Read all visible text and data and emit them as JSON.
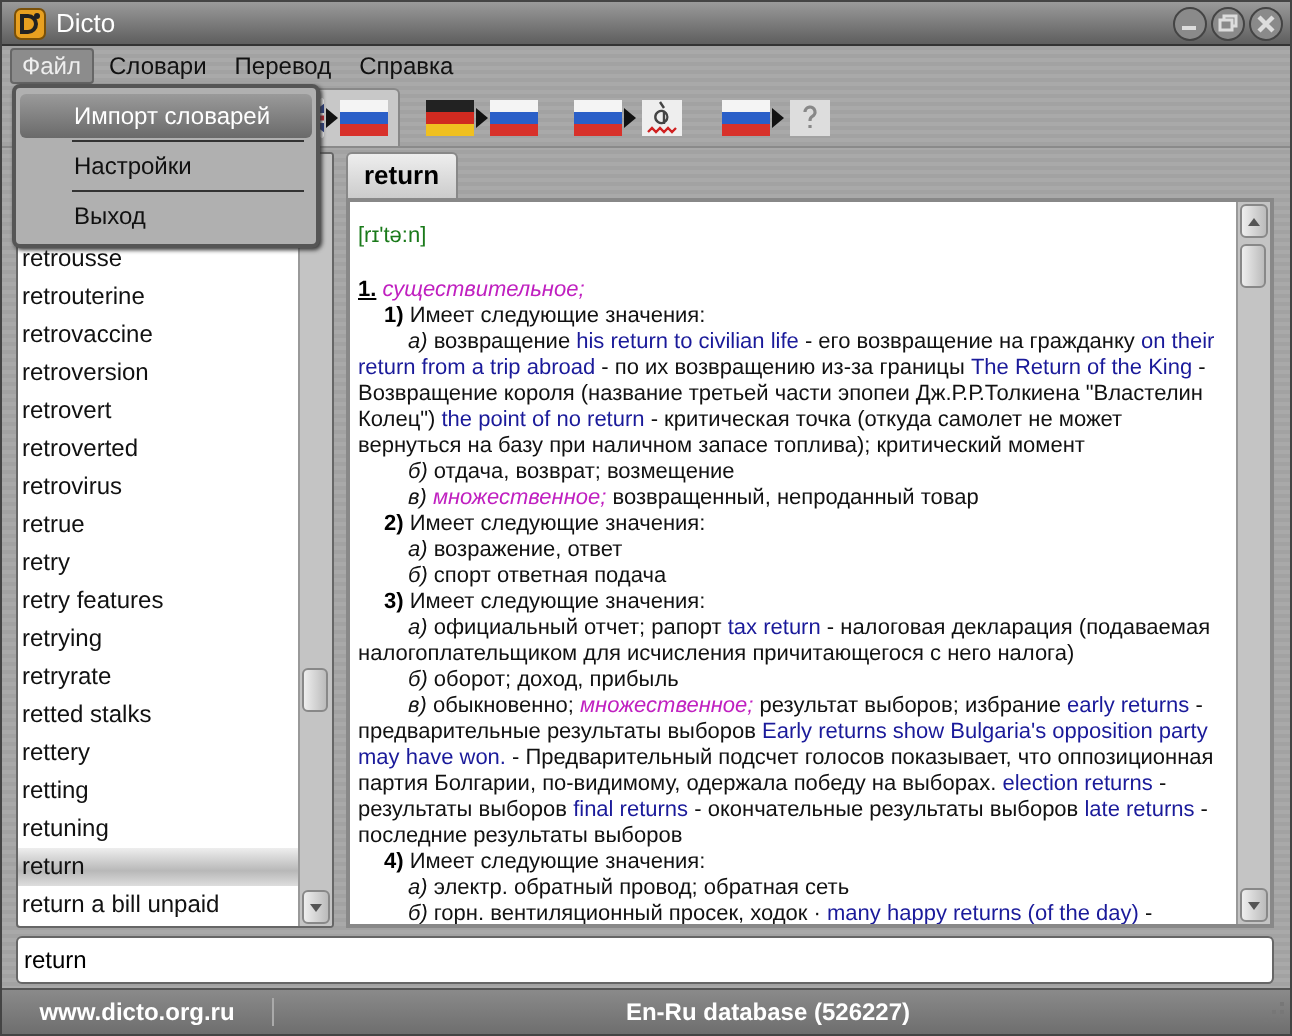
{
  "window": {
    "title": "Dicto"
  },
  "menu": [
    {
      "label": "Файл",
      "selected": true
    },
    {
      "label": "Словари",
      "selected": false
    },
    {
      "label": "Перевод",
      "selected": false
    },
    {
      "label": "Справка",
      "selected": false
    }
  ],
  "file_menu": {
    "items": [
      {
        "label": "Импорт словарей",
        "selected": true
      },
      {
        "label": "Настройки",
        "selected": false
      },
      {
        "label": "Выход",
        "selected": false
      }
    ]
  },
  "toolbar": [
    {
      "selected": true
    },
    {
      "selected": false
    },
    {
      "selected": false
    },
    {
      "selected": false
    }
  ],
  "word_list": {
    "items": [
      {
        "text": "retrousse",
        "selected": false
      },
      {
        "text": "retrouterine",
        "selected": false
      },
      {
        "text": "retrovaccine",
        "selected": false
      },
      {
        "text": "retroversion",
        "selected": false
      },
      {
        "text": "retrovert",
        "selected": false
      },
      {
        "text": "retroverted",
        "selected": false
      },
      {
        "text": "retrovirus",
        "selected": false
      },
      {
        "text": "retrue",
        "selected": false
      },
      {
        "text": "retry",
        "selected": false
      },
      {
        "text": "retry features",
        "selected": false
      },
      {
        "text": "retrying",
        "selected": false
      },
      {
        "text": "retryrate",
        "selected": false
      },
      {
        "text": "retted stalks",
        "selected": false
      },
      {
        "text": "rettery",
        "selected": false
      },
      {
        "text": "retting",
        "selected": false
      },
      {
        "text": "retuning",
        "selected": false
      },
      {
        "text": "return",
        "selected": true
      },
      {
        "text": "return a bill unpaid",
        "selected": false
      }
    ]
  },
  "article": {
    "tab": "return",
    "transcription": "[rɪ'tə:n]",
    "blocks": [
      {
        "kind": "pos",
        "parts": [
          {
            "kind": "marker",
            "text": "1."
          },
          {
            "kind": "label",
            "text": " существительное;"
          }
        ]
      },
      {
        "kind": "sense",
        "parts": [
          {
            "kind": "marker",
            "text": "1)"
          },
          {
            "kind": "text",
            "text": " Имеет следующие значения:"
          }
        ]
      },
      {
        "kind": "sub",
        "parts": [
          {
            "kind": "submarker",
            "text": "а)"
          },
          {
            "kind": "text",
            "text": " возвращение "
          },
          {
            "kind": "example",
            "text": "his return to civilian life"
          },
          {
            "kind": "text",
            "text": " - его возвращение на гражданку "
          },
          {
            "kind": "example",
            "text": "on their return from a trip abroad"
          },
          {
            "kind": "text",
            "text": " - по их возвращению из-за границы "
          },
          {
            "kind": "example",
            "text": "The Return of the King"
          },
          {
            "kind": "text",
            "text": " - Возвращение короля (название третьей части эпопеи Дж.Р.Р.Толкиена \"Властелин Колец\") "
          },
          {
            "kind": "example",
            "text": "the point of no return"
          },
          {
            "kind": "text",
            "text": " - критическая точка (откуда самолет не может вернуться на базу при наличном запасе топлива); критический момент"
          }
        ]
      },
      {
        "kind": "sub",
        "parts": [
          {
            "kind": "submarker",
            "text": "б)"
          },
          {
            "kind": "text",
            "text": " отдача, возврат; возмещение"
          }
        ]
      },
      {
        "kind": "sub",
        "parts": [
          {
            "kind": "submarker",
            "text": "в)"
          },
          {
            "kind": "label",
            "text": " множественное;"
          },
          {
            "kind": "text",
            "text": " возвращенный, непроданный товар"
          }
        ]
      },
      {
        "kind": "sense",
        "parts": [
          {
            "kind": "marker",
            "text": "2)"
          },
          {
            "kind": "text",
            "text": " Имеет следующие значения:"
          }
        ]
      },
      {
        "kind": "sub",
        "parts": [
          {
            "kind": "submarker",
            "text": "а)"
          },
          {
            "kind": "text",
            "text": " возражение, ответ"
          }
        ]
      },
      {
        "kind": "sub",
        "parts": [
          {
            "kind": "submarker",
            "text": "б)"
          },
          {
            "kind": "text",
            "text": " спорт ответная подача"
          }
        ]
      },
      {
        "kind": "sense",
        "parts": [
          {
            "kind": "marker",
            "text": "3)"
          },
          {
            "kind": "text",
            "text": " Имеет следующие значения:"
          }
        ]
      },
      {
        "kind": "sub",
        "parts": [
          {
            "kind": "submarker",
            "text": "а)"
          },
          {
            "kind": "text",
            "text": " официальный отчет; рапорт "
          },
          {
            "kind": "example",
            "text": "tax return"
          },
          {
            "kind": "text",
            "text": " - налоговая декларация (подаваемая налогоплательщиком для исчисления причитающегося с него налога)"
          }
        ]
      },
      {
        "kind": "sub",
        "parts": [
          {
            "kind": "submarker",
            "text": "б)"
          },
          {
            "kind": "text",
            "text": " оборот; доход, прибыль"
          }
        ]
      },
      {
        "kind": "sub",
        "parts": [
          {
            "kind": "submarker",
            "text": "в)"
          },
          {
            "kind": "text",
            "text": " обыкновенно; "
          },
          {
            "kind": "label",
            "text": "множественное;"
          },
          {
            "kind": "text",
            "text": " результат выборов; избрание "
          },
          {
            "kind": "example",
            "text": "early returns"
          },
          {
            "kind": "text",
            "text": " - предварительные результаты выборов "
          },
          {
            "kind": "example",
            "text": "Early returns show Bulgaria's opposition party may have won."
          },
          {
            "kind": "text",
            "text": " - Предварительный подсчет голосов показывает, что оппозиционная партия Болгарии, по-видимому, одержала победу на выборах. "
          },
          {
            "kind": "example",
            "text": "election returns"
          },
          {
            "kind": "text",
            "text": " - результаты выборов "
          },
          {
            "kind": "example",
            "text": "final returns"
          },
          {
            "kind": "text",
            "text": " - окончательные результаты выборов "
          },
          {
            "kind": "example",
            "text": "late returns"
          },
          {
            "kind": "text",
            "text": " - последние результаты выборов"
          }
        ]
      },
      {
        "kind": "sense",
        "parts": [
          {
            "kind": "marker",
            "text": "4)"
          },
          {
            "kind": "text",
            "text": " Имеет следующие значения:"
          }
        ]
      },
      {
        "kind": "sub",
        "parts": [
          {
            "kind": "submarker",
            "text": "а)"
          },
          {
            "kind": "text",
            "text": " электр. обратный провод; обратная сеть"
          }
        ]
      },
      {
        "kind": "sub",
        "parts": [
          {
            "kind": "submarker",
            "text": "б)"
          },
          {
            "kind": "text",
            "text": " горн. вентиляционный просек, ходок · "
          },
          {
            "kind": "example",
            "text": "many happy returns (of the day)"
          },
          {
            "kind": "text",
            "text": " -"
          }
        ]
      }
    ]
  },
  "search": {
    "value": "return"
  },
  "status_bar": {
    "site": "www.dicto.org.ru",
    "database": "En-Ru database (526227)"
  }
}
